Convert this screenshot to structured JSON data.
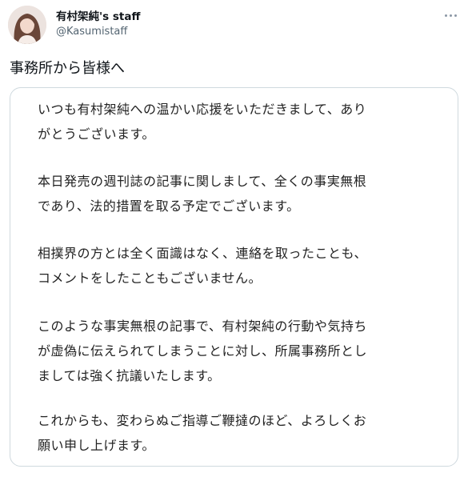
{
  "tweet": {
    "display_name": "有村架純's staff",
    "handle": "@Kasumistaff",
    "text": "事務所から皆様へ"
  },
  "statement": {
    "paragraphs": [
      {
        "lines": [
          "いつも有村架純への温かい応援をいただきまして、あり",
          "がとうございます。"
        ]
      },
      {
        "lines": [
          "本日発売の週刊誌の記事に関しまして、全くの事実無根",
          "であり、法的措置を取る予定でございます。"
        ]
      },
      {
        "lines": [
          "相撲界の方とは全く面識はなく、連絡を取ったことも、",
          "コメントをしたこともございません。"
        ]
      },
      {
        "lines": [
          "このような事実無根の記事で、有村架純の行動や気持ち",
          "が虚偽に伝えられてしまうことに対し、所属事務所とし",
          "ましては強く抗議いたします。"
        ]
      },
      {
        "lines": [
          "これからも、変わらぬご指導ご鞭撻のほど、よろしくお",
          "願い申し上げます。"
        ]
      }
    ]
  },
  "icons": {
    "more": "more-horizontal-icon",
    "avatar": "avatar-photo"
  },
  "colors": {
    "text_primary": "#0f1419",
    "text_secondary": "#536471",
    "card_border": "#cfd9de",
    "statement_text": "#222222"
  }
}
